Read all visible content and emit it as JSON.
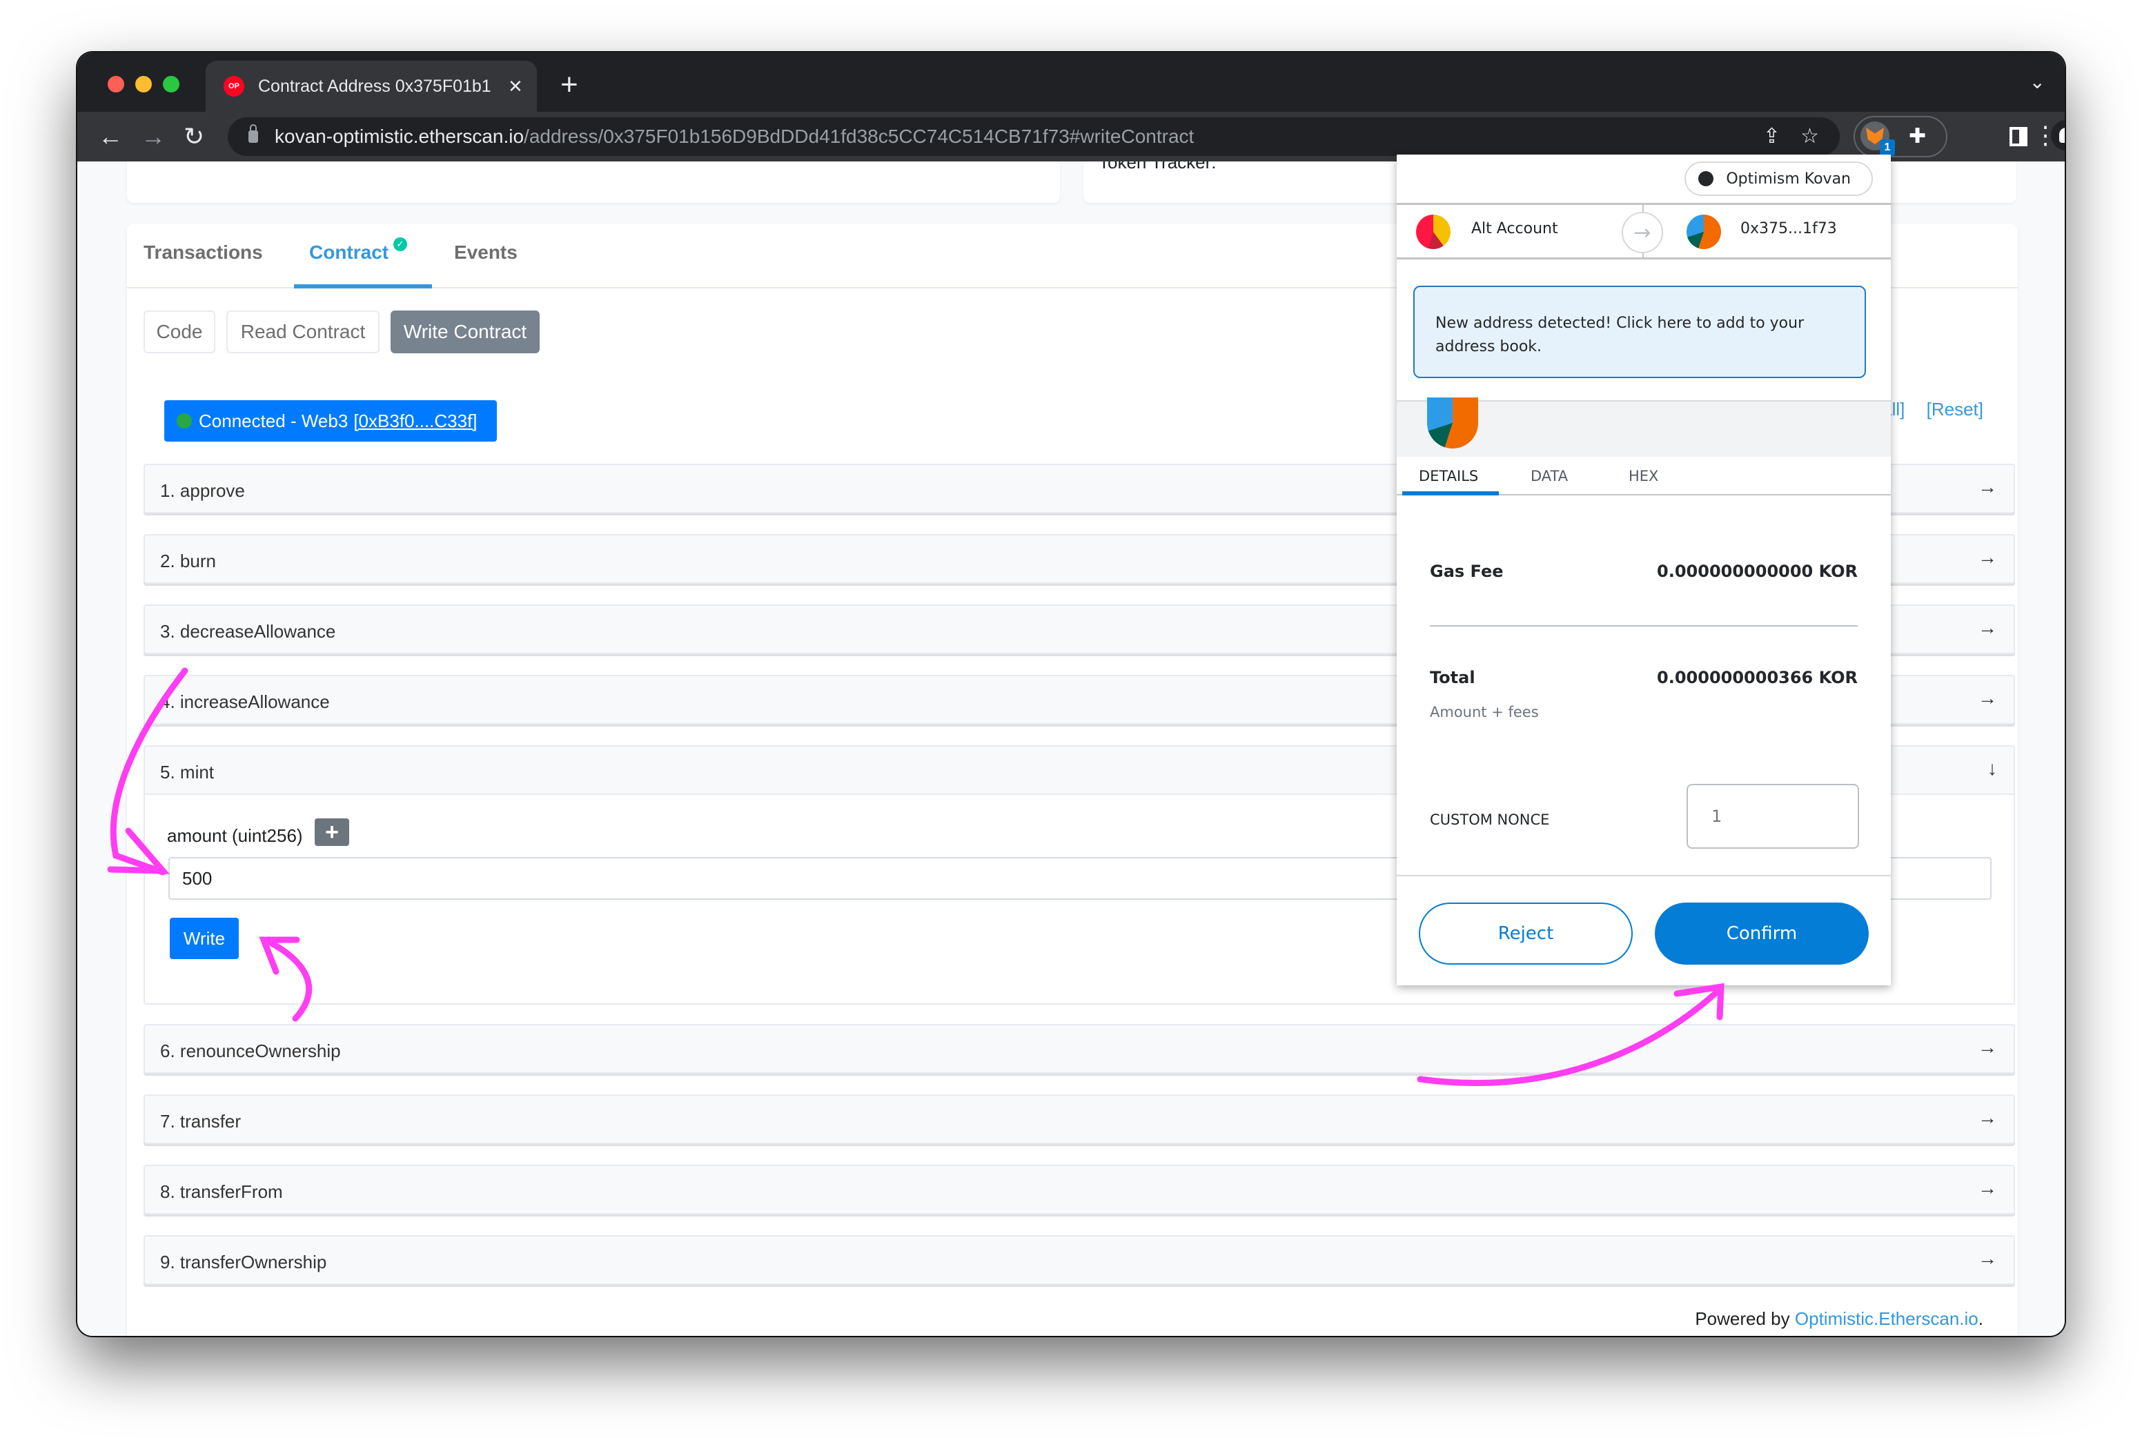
{
  "browser": {
    "tab_title": "Contract Address 0x375F01b1",
    "tab_favicon_text": "OP",
    "url_host": "kovan-optimistic.etherscan.io",
    "url_path": "/address/0x375F01b156D9BdDDd41fd38c5CC74C514CB71f73#writeContract",
    "extension_badge": "1"
  },
  "page": {
    "token_tracker_label": "Token Tracker:",
    "tabs": [
      {
        "label": "Transactions",
        "active": false
      },
      {
        "label": "Contract",
        "active": true,
        "verified": true
      },
      {
        "label": "Events",
        "active": false
      }
    ],
    "sub_buttons": [
      {
        "label": "Code",
        "active": false
      },
      {
        "label": "Read Contract",
        "active": false
      },
      {
        "label": "Write Contract",
        "active": true
      }
    ],
    "connected_text": "Connected - Web3",
    "connected_address": "[0xB3f0....C33f]",
    "expand_all_label": "all]",
    "reset_label": "[Reset]",
    "functions": [
      {
        "label": "1. approve",
        "expanded": false
      },
      {
        "label": "2. burn",
        "expanded": false
      },
      {
        "label": "3. decreaseAllowance",
        "expanded": false
      },
      {
        "label": "4. increaseAllowance",
        "expanded": false
      },
      {
        "label": "5. mint",
        "expanded": true
      },
      {
        "label": "6. renounceOwnership",
        "expanded": false
      },
      {
        "label": "7. transfer",
        "expanded": false
      },
      {
        "label": "8. transferFrom",
        "expanded": false
      },
      {
        "label": "9. transferOwnership",
        "expanded": false
      }
    ],
    "mint": {
      "param_label": "amount (uint256)",
      "param_value": "500",
      "add_button": "+",
      "write_button": "Write"
    },
    "footer_prefix": "Powered by",
    "footer_link": "Optimistic.Etherscan.io",
    "footer_suffix": "."
  },
  "metamask": {
    "network": "Optimism Kovan",
    "from_account": "Alt Account",
    "to_account": "0x375...1f73",
    "notice": "New address detected! Click here to add to your address book.",
    "tabs": [
      "DETAILS",
      "DATA",
      "HEX"
    ],
    "active_tab": "DETAILS",
    "gas_fee_label": "Gas Fee",
    "gas_fee_value": "0.000000000000 KOR",
    "total_label": "Total",
    "total_value": "0.000000000366 KOR",
    "total_sub": "Amount + fees",
    "nonce_label": "CUSTOM NONCE",
    "nonce_placeholder": "1",
    "reject_label": "Reject",
    "confirm_label": "Confirm",
    "accent": "#037dd6"
  },
  "colors": {
    "etherscan_blue": "#3498db",
    "button_blue": "#007bff",
    "annotation": "#ff3df2"
  }
}
